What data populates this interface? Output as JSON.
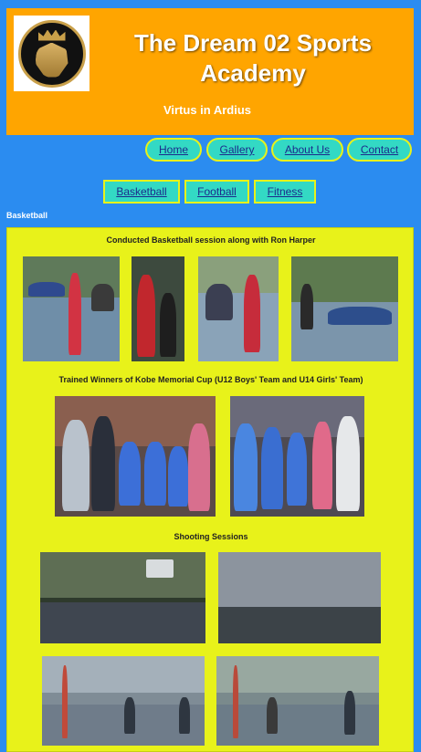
{
  "header": {
    "title": "The Dream 02 Sports Academy",
    "motto": "Virtus in Ardius",
    "logo_icon": "lion-crown-logo",
    "background": "#ffa500"
  },
  "nav": {
    "items": [
      {
        "label": "Home"
      },
      {
        "label": "Gallery"
      },
      {
        "label": "About Us"
      },
      {
        "label": "Contact"
      }
    ]
  },
  "sports": {
    "items": [
      {
        "label": "Basketball"
      },
      {
        "label": "Football"
      },
      {
        "label": "Fitness"
      }
    ]
  },
  "section": {
    "label": "Basketball",
    "captions": [
      "Conducted Basketball session along with Ron Harper",
      "Trained Winners of Kobe Memorial Cup (U12 Boys' Team and U14 Girls' Team)",
      "Shooting Sessions"
    ]
  },
  "colors": {
    "page_bg": "#2b8cf0",
    "panel_bg": "#e8f21a",
    "button_bg": "#33d9c4",
    "button_border": "#e8f21a",
    "link_text": "#1c2a8c"
  }
}
